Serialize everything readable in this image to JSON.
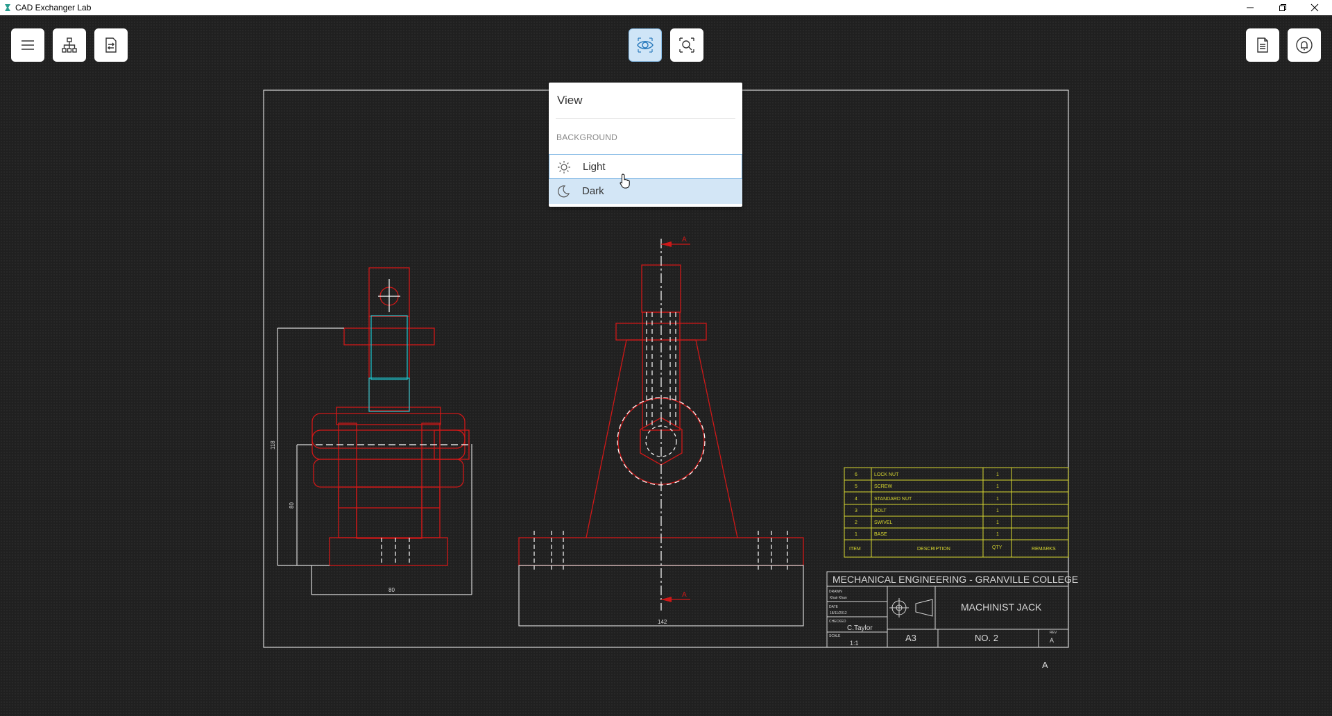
{
  "window": {
    "title": "CAD Exchanger Lab",
    "controls": [
      "minimize-icon",
      "restore-icon",
      "close-icon"
    ]
  },
  "toolbar": {
    "left": [
      "menu-icon",
      "structure-tree-icon",
      "convert-icon"
    ],
    "center": [
      "view-eye-icon",
      "fit-zoom-icon"
    ],
    "right": [
      "properties-document-icon",
      "notifications-bell-icon"
    ]
  },
  "view_menu": {
    "title": "View",
    "section": "BACKGROUND",
    "options": [
      {
        "label": "Light",
        "icon": "sun-icon"
      },
      {
        "label": "Dark",
        "icon": "moon-icon",
        "selected": true
      }
    ]
  },
  "drawing": {
    "colors": {
      "frame": "#d8d8d8",
      "lines": "#d01818",
      "table": "#d8d830",
      "accent": "#1ec8d0"
    },
    "dimensions": {
      "height_total": "118",
      "height_inner": "80",
      "base_width_left": "80",
      "base_width_front": "142"
    },
    "section_marker": "A",
    "parts_table": {
      "headers": [
        "ITEM",
        "DESCRIPTION",
        "QTY",
        "REMARKS"
      ],
      "rows": [
        {
          "item": "6",
          "description": "LOCK NUT",
          "qty": "1"
        },
        {
          "item": "5",
          "description": "SCREW",
          "qty": "1"
        },
        {
          "item": "4",
          "description": "STANDARD NUT",
          "qty": "1"
        },
        {
          "item": "3",
          "description": "BOLT",
          "qty": "1"
        },
        {
          "item": "2",
          "description": "SWIVEL",
          "qty": "1"
        },
        {
          "item": "1",
          "description": "BASE",
          "qty": "1"
        }
      ]
    },
    "title_block": {
      "institution": "MECHANICAL ENGINEERING - GRANVILLE COLLEGE",
      "drawn_label": "DRAWN",
      "drawn_by": "Khair Khan",
      "date_label": "DATE",
      "date": "18/11/2012",
      "checked_label": "CHECKED",
      "checked_by": "C.Taylor",
      "scale_label": "SCALE",
      "scale": "1:1",
      "title": "MACHINIST JACK",
      "sheet_size": "A3",
      "number": "NO. 2",
      "rev_label": "REV",
      "rev": "A"
    },
    "footer_letter": "A"
  }
}
